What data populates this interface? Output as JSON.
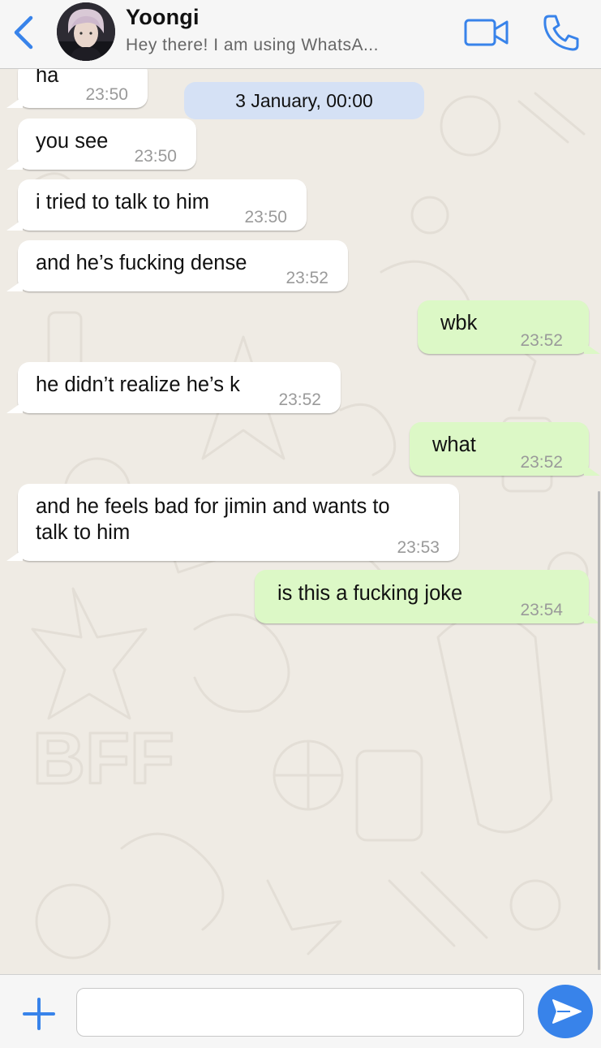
{
  "header": {
    "contact_name": "Yoongi",
    "contact_status": "Hey there! I am using WhatsA...",
    "back_icon": "chevron-left-icon",
    "video_icon": "video-camera-icon",
    "call_icon": "phone-icon"
  },
  "chat": {
    "date_divider": "3 January, 00:00",
    "messages": [
      {
        "direction": "in",
        "text": "ha",
        "time": "23:50"
      },
      {
        "direction": "in",
        "text": "you see",
        "time": "23:50"
      },
      {
        "direction": "in",
        "text": "i tried to talk to him",
        "time": "23:50"
      },
      {
        "direction": "in",
        "text": "and he’s fucking dense",
        "time": "23:52"
      },
      {
        "direction": "out",
        "text": "wbk",
        "time": "23:52"
      },
      {
        "direction": "in",
        "text": "he didn’t realize he’s k",
        "time": "23:52"
      },
      {
        "direction": "out",
        "text": "what",
        "time": "23:52"
      },
      {
        "direction": "in",
        "text_lines": [
          "and he feels bad for jimin and wants to",
          "talk to him"
        ],
        "time": "23:53"
      },
      {
        "direction": "out",
        "text": "is this a fucking joke",
        "time": "23:54"
      }
    ]
  },
  "composer": {
    "input_value": "",
    "input_placeholder": "",
    "plus_icon": "plus-icon",
    "send_icon": "send-icon"
  },
  "colors": {
    "accent": "#3883ea",
    "incoming_bubble": "#ffffff",
    "outgoing_bubble": "#dcf8c6",
    "date_pill": "#d5e1f5",
    "chat_background": "#efebe4"
  }
}
